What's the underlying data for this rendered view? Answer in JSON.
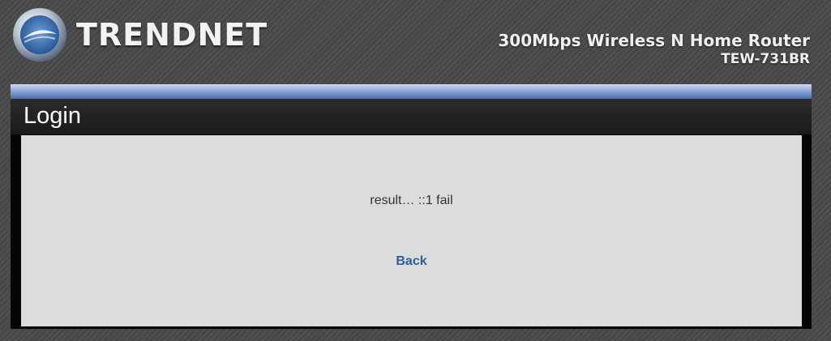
{
  "header": {
    "logo_text": "TRENDNET",
    "logo_icon": "trendnet-logo-icon",
    "product_name": "300Mbps Wireless N Home Router",
    "model": "TEW-731BR"
  },
  "panel": {
    "title": "Login",
    "message": "result… ::1 fail",
    "back_label": "Back"
  },
  "colors": {
    "page_background": "#4a4a4a",
    "accent_bar": "#90a9d8",
    "content_background": "#dcdcdc",
    "link": "#2e5d9c"
  }
}
